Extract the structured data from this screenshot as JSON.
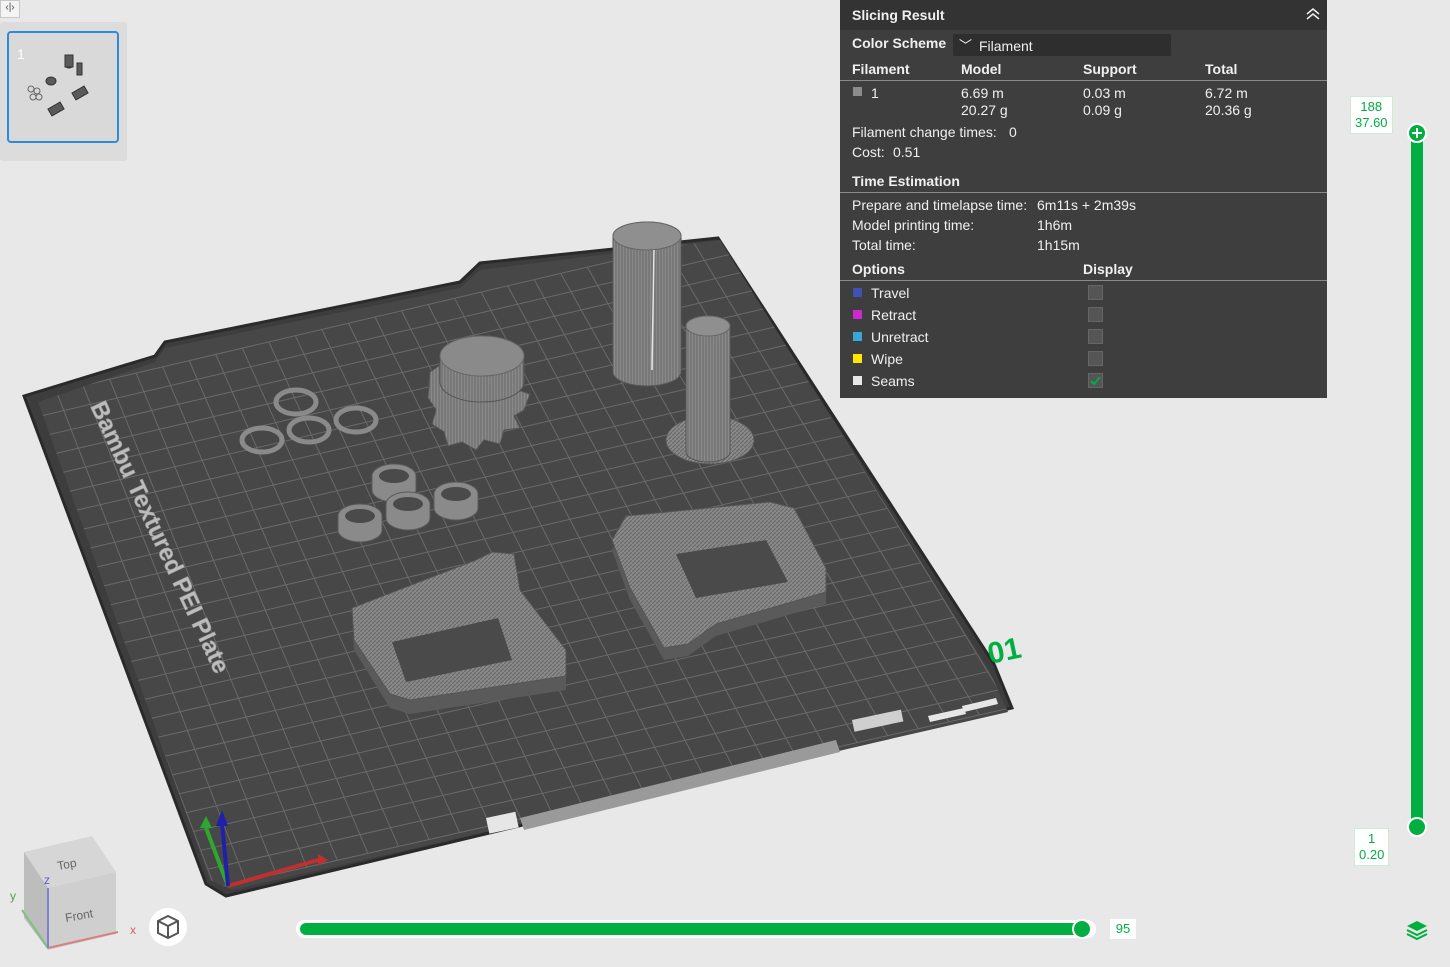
{
  "thumbnail": {
    "plate_number": "1"
  },
  "bed": {
    "brand_text": "Bambu Textured PEI Plate",
    "plate_label": "01"
  },
  "slicing_result": {
    "title": "Slicing Result",
    "color_scheme_label": "Color Scheme",
    "color_scheme_value": "Filament",
    "table_headers": [
      "Filament",
      "Model",
      "Support",
      "Total"
    ],
    "filament_row": {
      "id": "1",
      "swatch_color": "#8c8c8c",
      "model_length": "6.69 m",
      "model_weight": "20.27 g",
      "support_length": "0.03 m",
      "support_weight": "0.09 g",
      "total_length": "6.72 m",
      "total_weight": "20.36 g"
    },
    "filament_change_label": "Filament change times:",
    "filament_change_value": "0",
    "cost_label": "Cost:",
    "cost_value": "0.51",
    "time_title": "Time Estimation",
    "prepare_label": "Prepare and timelapse time:",
    "prepare_value": "6m11s + 2m39s",
    "model_time_label": "Model printing time:",
    "model_time_value": "1h6m",
    "total_time_label": "Total time:",
    "total_time_value": "1h15m",
    "options_header": "Options",
    "display_header": "Display",
    "options": [
      {
        "label": "Travel",
        "color": "#3f51b5",
        "checked": false
      },
      {
        "label": "Retract",
        "color": "#d028d0",
        "checked": false
      },
      {
        "label": "Unretract",
        "color": "#3aa6d8",
        "checked": false
      },
      {
        "label": "Wipe",
        "color": "#ffe600",
        "checked": false
      },
      {
        "label": "Seams",
        "color": "#e8e8e8",
        "checked": true
      }
    ]
  },
  "layer_slider": {
    "top_layer": "188",
    "top_height": "37.60",
    "bottom_layer": "1",
    "bottom_height": "0.20"
  },
  "move_slider": {
    "value": "95",
    "fraction": 0.99
  },
  "view_cube": {
    "top_label": "Top",
    "front_label": "Front",
    "x_axis": "x",
    "y_axis": "y",
    "z_axis": "z"
  },
  "colors": {
    "accent": "#00ae42",
    "panel_bg": "#3e3e3e",
    "bed": "#4a4a4a"
  }
}
